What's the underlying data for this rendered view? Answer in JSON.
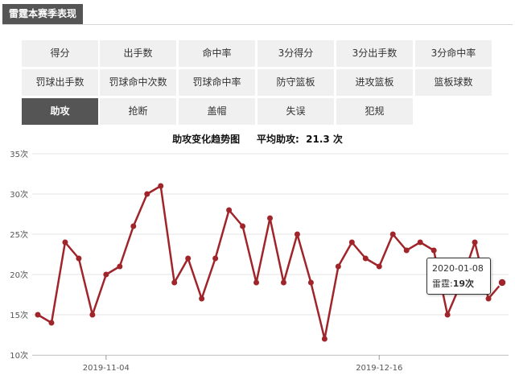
{
  "panel": {
    "title": "雷霆本赛季表现"
  },
  "tabs": [
    {
      "label": "得分"
    },
    {
      "label": "出手数"
    },
    {
      "label": "命中率"
    },
    {
      "label": "3分得分"
    },
    {
      "label": "3分出手数"
    },
    {
      "label": "3分命中率"
    },
    {
      "label": "罚球出手数"
    },
    {
      "label": "罚球命中次数"
    },
    {
      "label": "罚球命中率"
    },
    {
      "label": "防守篮板"
    },
    {
      "label": "进攻篮板"
    },
    {
      "label": "篮板球数"
    },
    {
      "label": "助攻",
      "active": true
    },
    {
      "label": "抢断"
    },
    {
      "label": "盖帽"
    },
    {
      "label": "失误"
    },
    {
      "label": "犯规"
    }
  ],
  "chart_title": {
    "name": "助攻变化趋势图",
    "avg_label": "平均助攻:",
    "avg_value": "21.3 次"
  },
  "tooltip": {
    "date": "2020-01-08",
    "series_label": "雷霆:",
    "value_label": "19次"
  },
  "chart_data": {
    "type": "line",
    "title": "助攻变化趋势图",
    "ylim": [
      10,
      35
    ],
    "y_ticks": [
      10,
      15,
      20,
      25,
      30,
      35
    ],
    "y_unit": "次",
    "x_tick_labels": [
      "2019-11-04",
      "2019-12-16"
    ],
    "grid": true,
    "line_color": "#a0252a",
    "series": [
      {
        "values": [
          15,
          14,
          24,
          22,
          15,
          20,
          21,
          26,
          30,
          31,
          19,
          22,
          17,
          22,
          28,
          26,
          19,
          27,
          19,
          25,
          19,
          12,
          21,
          24,
          22,
          21,
          25,
          23,
          24,
          23,
          15,
          19,
          24,
          17,
          19
        ]
      }
    ]
  }
}
